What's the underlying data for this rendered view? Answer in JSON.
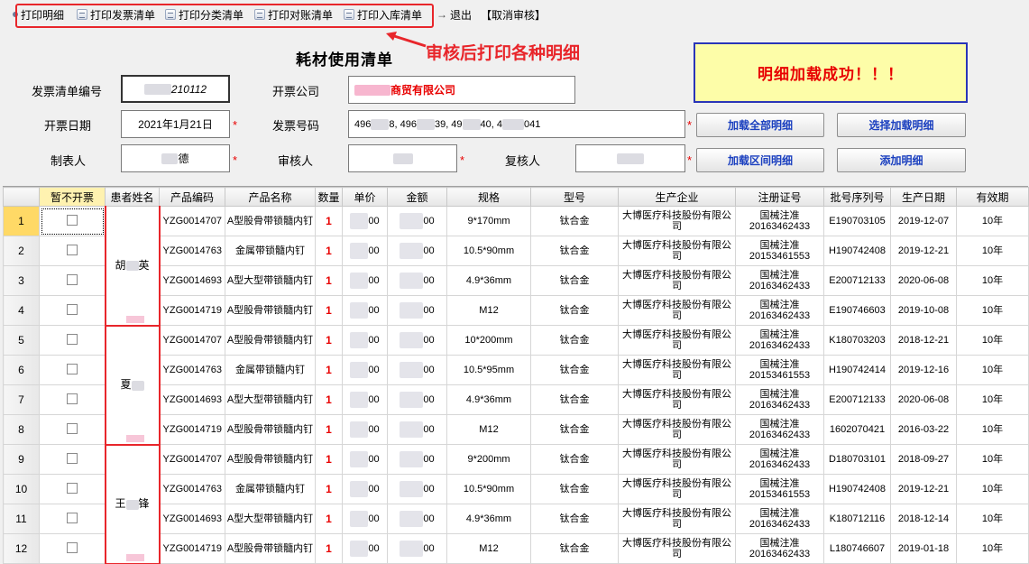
{
  "toolbar": {
    "items": [
      {
        "label": "打印明细",
        "icon": "printer-small-icon"
      },
      {
        "label": "打印发票清单",
        "icon": "print-document-icon"
      },
      {
        "label": "打印分类清单",
        "icon": "print-document-icon"
      },
      {
        "label": "打印对账清单",
        "icon": "print-document-icon"
      },
      {
        "label": "打印入库清单",
        "icon": "print-document-icon"
      },
      {
        "label": "退出",
        "icon": "exit-arrow-icon"
      }
    ],
    "cancel_review": "【取消审核】"
  },
  "annotation": "审核后打印各种明细",
  "form": {
    "title": "耗材使用清单",
    "invoice_list_no_label": "发票清单编号",
    "invoice_list_no": "210112",
    "company_label": "开票公司",
    "company": "商贸有限公司",
    "date_label": "开票日期",
    "date": "2021年1月21日",
    "invoice_no_label": "发票号码",
    "invoice_no_parts": [
      "496",
      "8, 496",
      "39, 49",
      "40, 4",
      "041"
    ],
    "maker_label": "制表人",
    "maker": "德",
    "reviewer_label": "审核人",
    "rechecker_label": "复核人",
    "required_mark": "*"
  },
  "buttons": {
    "load_all": "加载全部明细",
    "select_load": "选择加载明细",
    "load_range": "加载区间明细",
    "add_detail": "添加明细"
  },
  "status": "明细加载成功！！！",
  "colors": {
    "accent_red": "#e8262b",
    "button_text": "#1a3fbf",
    "status_bg": "#fdfda8",
    "status_border": "#2a35b8"
  },
  "table": {
    "headers": [
      "暂不开票",
      "患者姓名",
      "产品编码",
      "产品名称",
      "数量",
      "单价",
      "金额",
      "规格",
      "型号",
      "生产企业",
      "注册证号",
      "批号序列号",
      "生产日期",
      "有效期"
    ],
    "patients": [
      {
        "name": "胡英",
        "first": "胡",
        "last": "英"
      },
      {
        "name": "夏",
        "first": "夏",
        "last": ""
      },
      {
        "name": "王锋",
        "first": "王",
        "last": "锋"
      }
    ],
    "rows": [
      {
        "num": "1",
        "code": "YZG0014707",
        "name": "A型股骨带锁髓内钉",
        "qty": "1",
        "price": "00",
        "amount": "00",
        "spec": "9*170mm",
        "model": "钛合金",
        "maker": "大博医疗科技股份有限公司",
        "reg": "国械注准20163462433",
        "lot": "E190703105",
        "date": "2019-12-07",
        "valid": "10年"
      },
      {
        "num": "2",
        "code": "YZG0014763",
        "name": "金属带锁髓内钉",
        "qty": "1",
        "price": "00",
        "amount": "00",
        "spec": "10.5*90mm",
        "model": "钛合金",
        "maker": "大博医疗科技股份有限公司",
        "reg": "国械注准20153461553",
        "lot": "H190742408",
        "date": "2019-12-21",
        "valid": "10年"
      },
      {
        "num": "3",
        "code": "YZG0014693",
        "name": "A型大型带锁髓内钉",
        "qty": "1",
        "price": "00",
        "amount": "00",
        "spec": "4.9*36mm",
        "model": "钛合金",
        "maker": "大博医疗科技股份有限公司",
        "reg": "国械注准20163462433",
        "lot": "E200712133",
        "date": "2020-06-08",
        "valid": "10年"
      },
      {
        "num": "4",
        "code": "YZG0014719",
        "name": "A型股骨带锁髓内钉",
        "qty": "1",
        "price": "00",
        "amount": "00",
        "spec": "M12",
        "model": "钛合金",
        "maker": "大博医疗科技股份有限公司",
        "reg": "国械注准20163462433",
        "lot": "E190746603",
        "date": "2019-10-08",
        "valid": "10年"
      },
      {
        "num": "5",
        "code": "YZG0014707",
        "name": "A型股骨带锁髓内钉",
        "qty": "1",
        "price": "00",
        "amount": "00",
        "spec": "10*200mm",
        "model": "钛合金",
        "maker": "大博医疗科技股份有限公司",
        "reg": "国械注准20163462433",
        "lot": "K180703203",
        "date": "2018-12-21",
        "valid": "10年"
      },
      {
        "num": "6",
        "code": "YZG0014763",
        "name": "金属带锁髓内钉",
        "qty": "1",
        "price": "00",
        "amount": "00",
        "spec": "10.5*95mm",
        "model": "钛合金",
        "maker": "大博医疗科技股份有限公司",
        "reg": "国械注准20153461553",
        "lot": "H190742414",
        "date": "2019-12-16",
        "valid": "10年"
      },
      {
        "num": "7",
        "code": "YZG0014693",
        "name": "A型大型带锁髓内钉",
        "qty": "1",
        "price": "00",
        "amount": "00",
        "spec": "4.9*36mm",
        "model": "钛合金",
        "maker": "大博医疗科技股份有限公司",
        "reg": "国械注准20163462433",
        "lot": "E200712133",
        "date": "2020-06-08",
        "valid": "10年"
      },
      {
        "num": "8",
        "code": "YZG0014719",
        "name": "A型股骨带锁髓内钉",
        "qty": "1",
        "price": "00",
        "amount": "00",
        "spec": "M12",
        "model": "钛合金",
        "maker": "大博医疗科技股份有限公司",
        "reg": "国械注准20163462433",
        "lot": "1602070421",
        "date": "2016-03-22",
        "valid": "10年"
      },
      {
        "num": "9",
        "code": "YZG0014707",
        "name": "A型股骨带锁髓内钉",
        "qty": "1",
        "price": "00",
        "amount": "00",
        "spec": "9*200mm",
        "model": "钛合金",
        "maker": "大博医疗科技股份有限公司",
        "reg": "国械注准20163462433",
        "lot": "D180703101",
        "date": "2018-09-27",
        "valid": "10年"
      },
      {
        "num": "10",
        "code": "YZG0014763",
        "name": "金属带锁髓内钉",
        "qty": "1",
        "price": "00",
        "amount": "00",
        "spec": "10.5*90mm",
        "model": "钛合金",
        "maker": "大博医疗科技股份有限公司",
        "reg": "国械注准20153461553",
        "lot": "H190742408",
        "date": "2019-12-21",
        "valid": "10年"
      },
      {
        "num": "11",
        "code": "YZG0014693",
        "name": "A型大型带锁髓内钉",
        "qty": "1",
        "price": "00",
        "amount": "00",
        "spec": "4.9*36mm",
        "model": "钛合金",
        "maker": "大博医疗科技股份有限公司",
        "reg": "国械注准20163462433",
        "lot": "K180712116",
        "date": "2018-12-14",
        "valid": "10年"
      },
      {
        "num": "12",
        "code": "YZG0014719",
        "name": "A型股骨带锁髓内钉",
        "qty": "1",
        "price": "00",
        "amount": "00",
        "spec": "M12",
        "model": "钛合金",
        "maker": "大博医疗科技股份有限公司",
        "reg": "国械注准20163462433",
        "lot": "L180746607",
        "date": "2019-01-18",
        "valid": "10年"
      }
    ]
  }
}
